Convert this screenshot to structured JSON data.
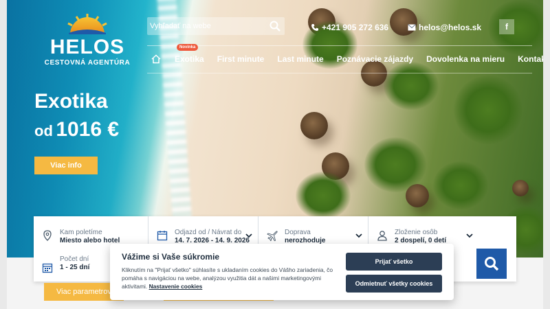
{
  "brand": {
    "name": "HELOS",
    "tagline": "CESTOVNÁ AGENTÚRA"
  },
  "header": {
    "search_placeholder": "Vyhľadať na webe",
    "phone": "+421 905 272 636",
    "email": "helos@helos.sk",
    "facebook_label": "f"
  },
  "nav": {
    "items": [
      {
        "label": "Exotika",
        "badge": "Novinka"
      },
      {
        "label": "First minute"
      },
      {
        "label": "Last minute"
      },
      {
        "label": "Poznávacie zájazdy"
      },
      {
        "label": "Dovolenka na mieru"
      },
      {
        "label": "Kontakt"
      }
    ]
  },
  "hero": {
    "title": "Exotika",
    "price_prefix": "od",
    "price": "1016 €",
    "cta": "Viac info"
  },
  "search_form": {
    "fields": [
      {
        "label": "Kam poletíme",
        "value": "Miesto alebo hotel"
      },
      {
        "label": "Odjazd od / Návrat do",
        "value": "14. 7. 2026 - 14. 9. 2026"
      },
      {
        "label": "Doprava",
        "value": "nerozhoduje"
      },
      {
        "label": "Zloženie osôb",
        "value": "2 dospelí, 0 detí"
      },
      {
        "label": "Počet dní",
        "value": "1 - 25 dní"
      }
    ],
    "params_button": "Viac parametrov"
  },
  "cookie": {
    "title": "Vážime si Vaše súkromie",
    "text": "Kliknutím na \"Prijať všetko\" súhlasíte s ukladaním cookies do Vášho zariadenia, čo pomáha s navigáciou na webe, analýzou využitia dát a našimi marketingovými aktivitami.",
    "settings_link": "Nastavenie cookies",
    "accept": "Prijať všetko",
    "reject": "Odmietnuť všetky cookies"
  },
  "colors": {
    "accent": "#f5b942",
    "primary": "#1f5aa8",
    "dark_button": "#2c3e55",
    "badge": "#ee5a3d"
  }
}
